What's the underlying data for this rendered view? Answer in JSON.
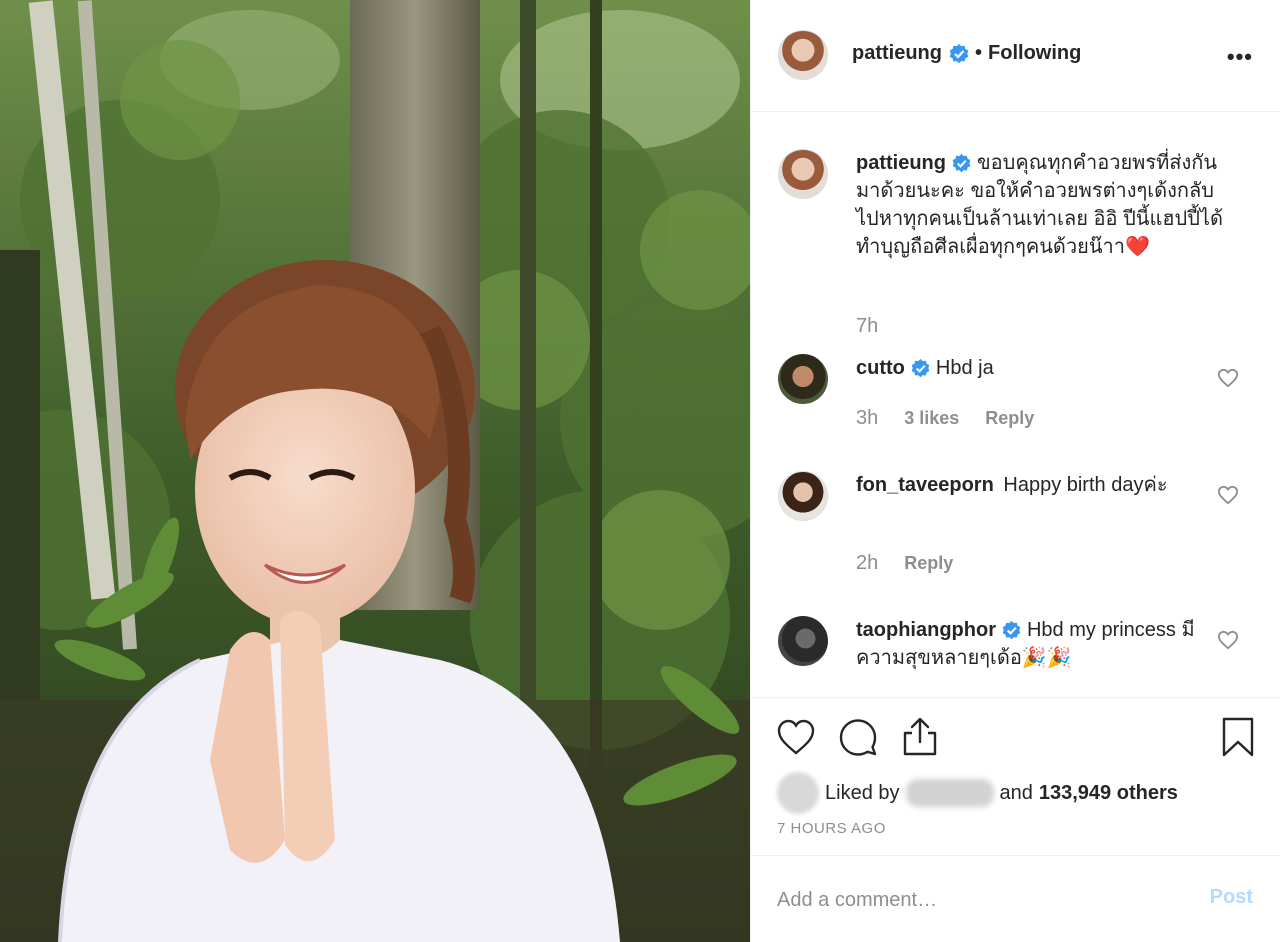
{
  "post": {
    "username": "pattieung",
    "separator": "•",
    "follow_label": "Following",
    "more_label": "•••",
    "caption": "ขอบคุณทุกคำอวยพรที่ส่งกันมาด้วยนะคะ ขอให้คำอวยพรต่างๆเด้งกลับไปหาทุกคนเป็นล้านเท่าเลย อิอิ ปีนี้แฮปปี้ได้ทำบุญถือศีลเผื่อทุกๆคนด้วยน๊าา❤️",
    "caption_time": "7h"
  },
  "comments": [
    {
      "username": "cutto",
      "verified": true,
      "text": "Hbd ja",
      "time": "3h",
      "likes": "3 likes",
      "reply": "Reply"
    },
    {
      "username": "fon_taveeporn",
      "verified": false,
      "text": "Happy birth dayค่ะ",
      "time": "2h",
      "likes": "",
      "reply": "Reply"
    },
    {
      "username": "taophiangphor",
      "verified": true,
      "text": "Hbd my princess มีความสุขหลายๆเด้อ🎉🎉",
      "time": "",
      "likes": "",
      "reply": ""
    }
  ],
  "actions": {
    "liked_by_label": "Liked by",
    "and_label": "and",
    "others_count": "133,949 others",
    "time_ago": "7 HOURS AGO",
    "icons": [
      "heart-icon",
      "comment-icon",
      "share-icon",
      "bookmark-icon"
    ]
  },
  "add_comment": {
    "placeholder": "Add a comment…",
    "post_label": "Post"
  },
  "colors": {
    "verified": "#3897f0",
    "muted": "#8e8e8e",
    "post_disabled": "#b3dbff",
    "text": "#262626"
  }
}
